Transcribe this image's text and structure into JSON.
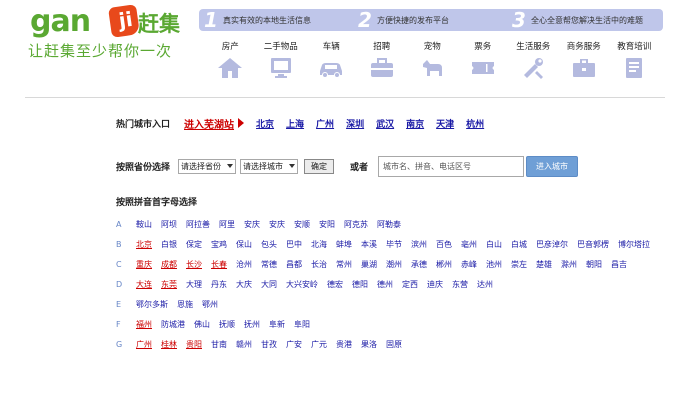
{
  "logo": {
    "word_a": "gan",
    "badge": "ji",
    "cn_name": "赶集",
    "slogan": "让赶集至少帮你一次"
  },
  "banner": [
    {
      "num": "1",
      "text": "真实有效的本地生活信息"
    },
    {
      "num": "2",
      "text": "方便快捷的发布平台"
    },
    {
      "num": "3",
      "text": "全心全意帮您解决生活中的难题"
    }
  ],
  "categories": [
    {
      "label": "房产",
      "icon": "house-icon"
    },
    {
      "label": "二手物品",
      "icon": "monitor-icon"
    },
    {
      "label": "车辆",
      "icon": "car-icon"
    },
    {
      "label": "招聘",
      "icon": "briefcase-icon"
    },
    {
      "label": "宠物",
      "icon": "dog-icon"
    },
    {
      "label": "票务",
      "icon": "ticket-icon"
    },
    {
      "label": "生活服务",
      "icon": "tools-icon"
    },
    {
      "label": "商务服务",
      "icon": "case-icon"
    },
    {
      "label": "教育培训",
      "icon": "book-icon"
    }
  ],
  "hot": {
    "label": "热门城市入口",
    "enter": "进入芜湖站",
    "cities": [
      "北京",
      "上海",
      "广州",
      "深圳",
      "武汉",
      "南京",
      "天津",
      "杭州"
    ]
  },
  "province": {
    "label": "按照省份选择",
    "province_select": "请选择省份",
    "city_select": "请选择城市",
    "ok": "确定",
    "or": "或者",
    "search_value": "城市名、拼音、电话区号",
    "enter_btn": "进入城市"
  },
  "pinyin_title": "按照拼音首字母选择",
  "letters": [
    {
      "letter": "A",
      "cities": [
        "鞍山",
        "阿坝",
        "阿拉善",
        "阿里",
        "安庆",
        "安庆",
        "安顺",
        "安阳",
        "阿克苏",
        "阿勒泰"
      ],
      "red": []
    },
    {
      "letter": "B",
      "cities": [
        "北京",
        "白银",
        "保定",
        "宝鸡",
        "保山",
        "包头",
        "巴中",
        "北海",
        "蚌埠",
        "本溪",
        "毕节",
        "滨州",
        "百色",
        "亳州",
        "白山",
        "白城",
        "巴彦淖尔",
        "巴音郭楞",
        "博尔塔拉"
      ],
      "red": [
        0
      ]
    },
    {
      "letter": "C",
      "cities": [
        "重庆",
        "成都",
        "长沙",
        "长春",
        "沧州",
        "常德",
        "昌都",
        "长治",
        "常州",
        "巢湖",
        "潮州",
        "承德",
        "郴州",
        "赤峰",
        "池州",
        "崇左",
        "楚雄",
        "滁州",
        "朝阳",
        "昌吉"
      ],
      "red": [
        0,
        1,
        2,
        3
      ]
    },
    {
      "letter": "D",
      "cities": [
        "大连",
        "东莞",
        "大理",
        "丹东",
        "大庆",
        "大同",
        "大兴安岭",
        "德宏",
        "德阳",
        "德州",
        "定西",
        "迪庆",
        "东营",
        "达州"
      ],
      "red": [
        0,
        1
      ]
    },
    {
      "letter": "E",
      "cities": [
        "鄂尔多斯",
        "恩施",
        "鄂州"
      ],
      "red": []
    },
    {
      "letter": "F",
      "cities": [
        "福州",
        "防城港",
        "佛山",
        "抚顺",
        "抚州",
        "阜新",
        "阜阳"
      ],
      "red": [
        0
      ]
    },
    {
      "letter": "G",
      "cities": [
        "广州",
        "桂林",
        "贵阳",
        "甘南",
        "赣州",
        "甘孜",
        "广安",
        "广元",
        "贵港",
        "果洛",
        "固原"
      ],
      "red": [
        0,
        1,
        2
      ]
    }
  ]
}
